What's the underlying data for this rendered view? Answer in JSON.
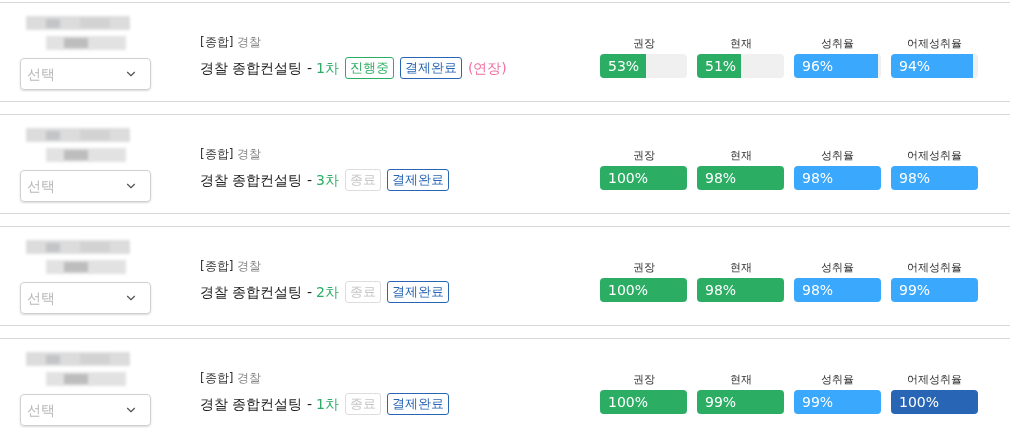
{
  "rows": [
    {
      "select": {
        "placeholder": "선택"
      },
      "category": "[종합]",
      "org": "경찰",
      "course": "경찰 종합컨설팅 -",
      "round": "1차",
      "badges": [
        {
          "kind": "active",
          "label": "진행중"
        },
        {
          "kind": "paid",
          "label": "결제완료"
        }
      ],
      "note": "(연장)",
      "meters": [
        {
          "label": "권장",
          "reading": "53%",
          "level": 0.53,
          "color": "#2bad63"
        },
        {
          "label": "현재",
          "reading": "51%",
          "level": 0.51,
          "color": "#2bad63"
        },
        {
          "label": "성취율",
          "reading": "96%",
          "level": 0.96,
          "color": "#3aa8fc"
        },
        {
          "label": "어제성취율",
          "reading": "94%",
          "level": 0.94,
          "color": "#3aa8fc"
        }
      ]
    },
    {
      "select": {
        "placeholder": "선택"
      },
      "category": "[종합]",
      "org": "경찰",
      "course": "경찰 종합컨설팅 -",
      "round": "3차",
      "badges": [
        {
          "kind": "ended",
          "label": "종료"
        },
        {
          "kind": "paid",
          "label": "결제완료"
        }
      ],
      "meters": [
        {
          "label": "권장",
          "reading": "100%",
          "level": 1,
          "color": "#2bad63"
        },
        {
          "label": "현재",
          "reading": "98%",
          "level": 1,
          "color": "#2bad63"
        },
        {
          "label": "성취율",
          "reading": "98%",
          "level": 1,
          "color": "#3aa8fc"
        },
        {
          "label": "어제성취율",
          "reading": "98%",
          "level": 1,
          "color": "#3aa8fc"
        }
      ]
    },
    {
      "select": {
        "placeholder": "선택"
      },
      "category": "[종합]",
      "org": "경찰",
      "course": "경찰 종합컨설팅 -",
      "round": "2차",
      "badges": [
        {
          "kind": "ended",
          "label": "종료"
        },
        {
          "kind": "paid",
          "label": "결제완료"
        }
      ],
      "meters": [
        {
          "label": "권장",
          "reading": "100%",
          "level": 1,
          "color": "#2bad63"
        },
        {
          "label": "현재",
          "reading": "98%",
          "level": 1,
          "color": "#2bad63"
        },
        {
          "label": "성취율",
          "reading": "98%",
          "level": 1,
          "color": "#3aa8fc"
        },
        {
          "label": "어제성취율",
          "reading": "99%",
          "level": 1,
          "color": "#3aa8fc"
        }
      ]
    },
    {
      "select": {
        "placeholder": "선택"
      },
      "category": "[종합]",
      "org": "경찰",
      "course": "경찰 종합컨설팅 -",
      "round": "1차",
      "badges": [
        {
          "kind": "ended",
          "label": "종료"
        },
        {
          "kind": "paid",
          "label": "결제완료"
        }
      ],
      "meters": [
        {
          "label": "권장",
          "reading": "100%",
          "level": 1,
          "color": "#2bad63"
        },
        {
          "label": "현재",
          "reading": "99%",
          "level": 1,
          "color": "#2bad63"
        },
        {
          "label": "성취율",
          "reading": "99%",
          "level": 1,
          "color": "#3aa8fc"
        },
        {
          "label": "어제성취율",
          "reading": "100%",
          "level": 1,
          "color": "#2866b5"
        }
      ]
    }
  ]
}
